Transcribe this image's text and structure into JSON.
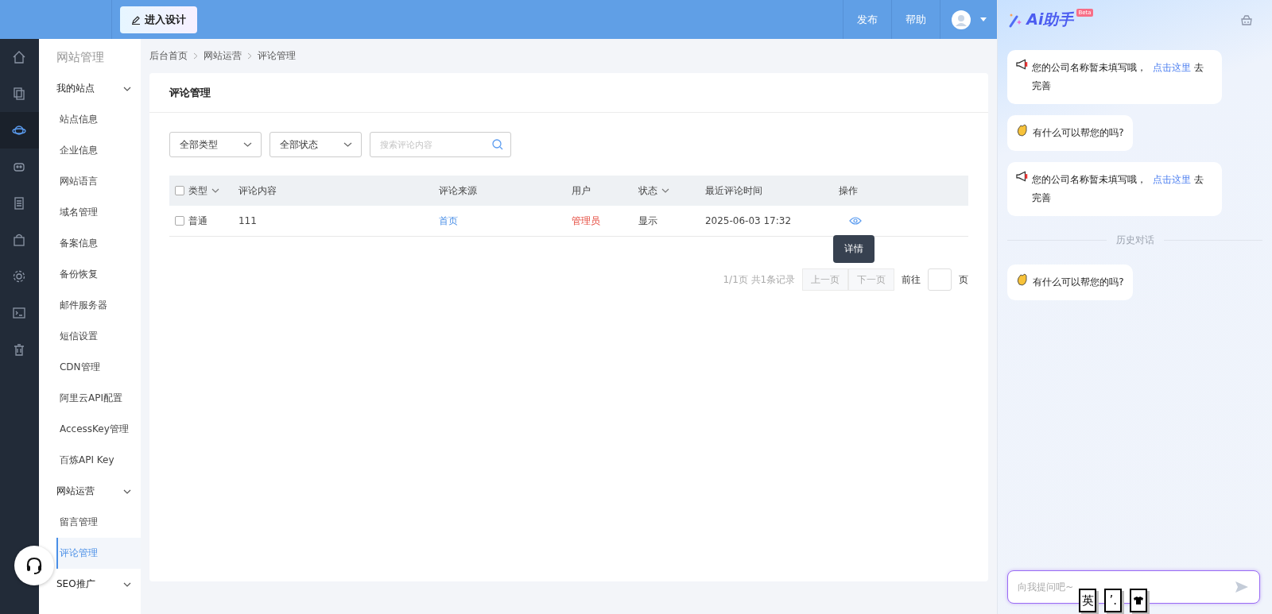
{
  "topbar": {
    "design_button": "进入设计",
    "actions": [
      "发布",
      "帮助"
    ]
  },
  "rail": [
    {
      "kind": "home",
      "selected": false
    },
    {
      "kind": "copy",
      "selected": false
    },
    {
      "kind": "planet",
      "selected": true
    },
    {
      "kind": "robot",
      "selected": false
    },
    {
      "kind": "doc",
      "selected": false
    },
    {
      "kind": "bag",
      "selected": false
    },
    {
      "kind": "gear",
      "selected": false
    },
    {
      "kind": "terminal",
      "selected": false
    },
    {
      "kind": "trash",
      "selected": false
    }
  ],
  "sidebar": {
    "title": "网站管理",
    "groups": [
      {
        "label": "我的站点",
        "expanded": true,
        "items": [
          {
            "label": "站点信息",
            "selected": false
          },
          {
            "label": "企业信息",
            "selected": false
          },
          {
            "label": "网站语言",
            "selected": false
          },
          {
            "label": "域名管理",
            "selected": false
          },
          {
            "label": "备案信息",
            "selected": false
          },
          {
            "label": "备份恢复",
            "selected": false
          },
          {
            "label": "邮件服务器",
            "selected": false
          },
          {
            "label": "短信设置",
            "selected": false
          },
          {
            "label": "CDN管理",
            "selected": false
          },
          {
            "label": "阿里云API配置",
            "selected": false
          },
          {
            "label": "AccessKey管理",
            "selected": false
          },
          {
            "label": "百炼API Key",
            "selected": false
          }
        ]
      },
      {
        "label": "网站运营",
        "expanded": true,
        "items": [
          {
            "label": "留言管理",
            "selected": false
          },
          {
            "label": "评论管理",
            "selected": true
          }
        ]
      },
      {
        "label": "SEO推广",
        "expanded": true
      }
    ]
  },
  "breadcrumb": [
    "后台首页",
    "网站运营",
    "评论管理"
  ],
  "card": {
    "title": "评论管理",
    "filters": [
      {
        "kind": "select",
        "value": "全部类型"
      },
      {
        "kind": "select",
        "value": "全部状态"
      },
      {
        "kind": "search",
        "placeholder": "搜索评论内容"
      }
    ],
    "table": {
      "all_checked": false,
      "columns": [
        {
          "label": "类型",
          "sortable": true
        },
        {
          "label": "评论内容",
          "sortable": false
        },
        {
          "label": "评论来源",
          "sortable": false
        },
        {
          "label": "用户",
          "sortable": false
        },
        {
          "label": "状态",
          "sortable": true
        },
        {
          "label": "最近评论时间",
          "sortable": false
        },
        {
          "label": "操作",
          "sortable": false
        }
      ],
      "rows": [
        {
          "checked": false,
          "type": "普通",
          "content": "111",
          "source": "首页",
          "user": "管理员",
          "status": "显示",
          "time": "2025-06-03 17:32"
        }
      ]
    },
    "tooltip": "详情",
    "pagination": {
      "summary": "1/1页 共1条记录",
      "prev": "上一页",
      "next": "下一页",
      "goto": "前往",
      "unit": "页"
    }
  },
  "assistant": {
    "title": "Ai助手",
    "badge": "Beta",
    "history_label": "历史对话",
    "messages": [
      {
        "kind": "notice",
        "text": "您的公司名称暂未填写哦，",
        "link": "点击这里",
        "suffix": "去完善"
      },
      {
        "kind": "greeting",
        "text": "有什么可以帮您的吗?"
      },
      {
        "kind": "notice",
        "text": "您的公司名称暂未填写哦，",
        "link": "点击这里",
        "suffix": "去完善"
      },
      {
        "kind": "divider"
      },
      {
        "kind": "greeting",
        "text": "有什么可以帮您的吗?"
      }
    ],
    "input_placeholder": "向我提问吧~",
    "ime": [
      "英",
      "’."
    ]
  }
}
